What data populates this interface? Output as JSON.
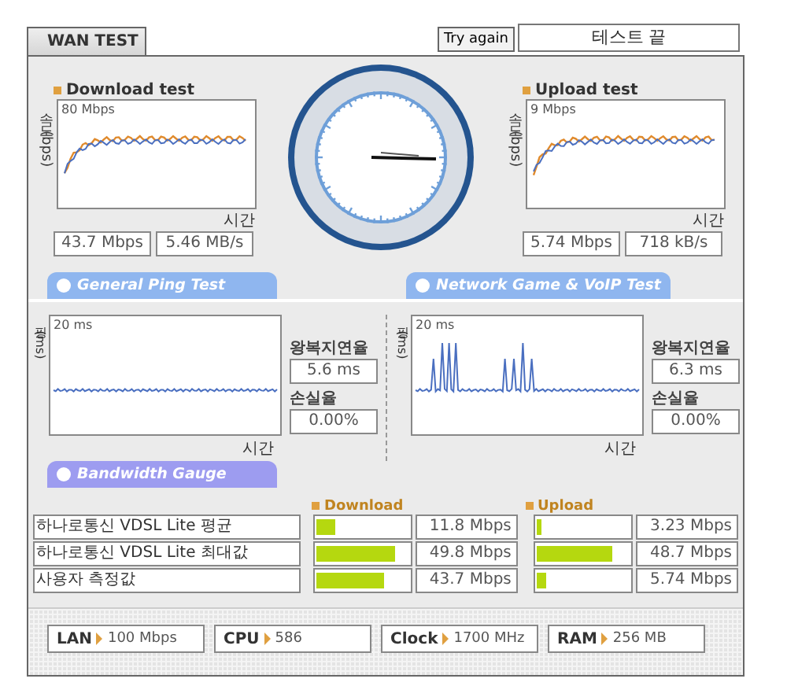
{
  "header": {
    "tab": "WAN TEST",
    "try_again": "Try again",
    "status": "테스트 끝"
  },
  "tests": [
    {
      "title": "Download test",
      "y_label": "속도(bps)",
      "scale": "80 Mbps",
      "x_label": "시간",
      "speed": "43.7 Mbps",
      "rate": "5.46 MB/s"
    },
    {
      "title": "Upload test",
      "y_label": "속도(bps)",
      "scale": "9 Mbps",
      "x_label": "시간",
      "speed": "5.74 Mbps",
      "rate": "718 kB/s"
    }
  ],
  "section_tabs": [
    "General Ping Test",
    "Network Game & VoIP Test"
  ],
  "ping": [
    {
      "y_label": "핑(ms)",
      "scale": "20 ms",
      "x_label": "시간",
      "latency_label": "왕복지연율",
      "latency": "5.6 ms",
      "loss_label": "손실율",
      "loss": "0.00%"
    },
    {
      "y_label": "핑(ms)",
      "scale": "20 ms",
      "x_label": "시간",
      "latency_label": "왕복지연율",
      "latency": "6.3 ms",
      "loss_label": "손실율",
      "loss": "0.00%"
    }
  ],
  "bandwidth": {
    "tab": "Bandwidth Gauge",
    "download_label": "Download",
    "upload_label": "Upload",
    "rows": [
      {
        "name": "하나로통신 VDSL Lite 평균",
        "download": {
          "level": 0.2,
          "reading": "11.8 Mbps"
        },
        "upload": {
          "level": 0.05,
          "reading": "3.23 Mbps"
        }
      },
      {
        "name": "하나로통신 VDSL Lite 최대값",
        "download": {
          "level": 0.85,
          "reading": "49.8 Mbps"
        },
        "upload": {
          "level": 0.8,
          "reading": "48.7 Mbps"
        }
      },
      {
        "name": "사용자 측정값",
        "download": {
          "level": 0.72,
          "reading": "43.7 Mbps"
        },
        "upload": {
          "level": 0.1,
          "reading": "5.74 Mbps"
        }
      }
    ]
  },
  "system": [
    {
      "label": "LAN",
      "value": "100 Mbps"
    },
    {
      "label": "CPU",
      "value": "586"
    },
    {
      "label": "Clock",
      "value": "1700 MHz"
    },
    {
      "label": "RAM",
      "value": "256 MB"
    }
  ]
}
